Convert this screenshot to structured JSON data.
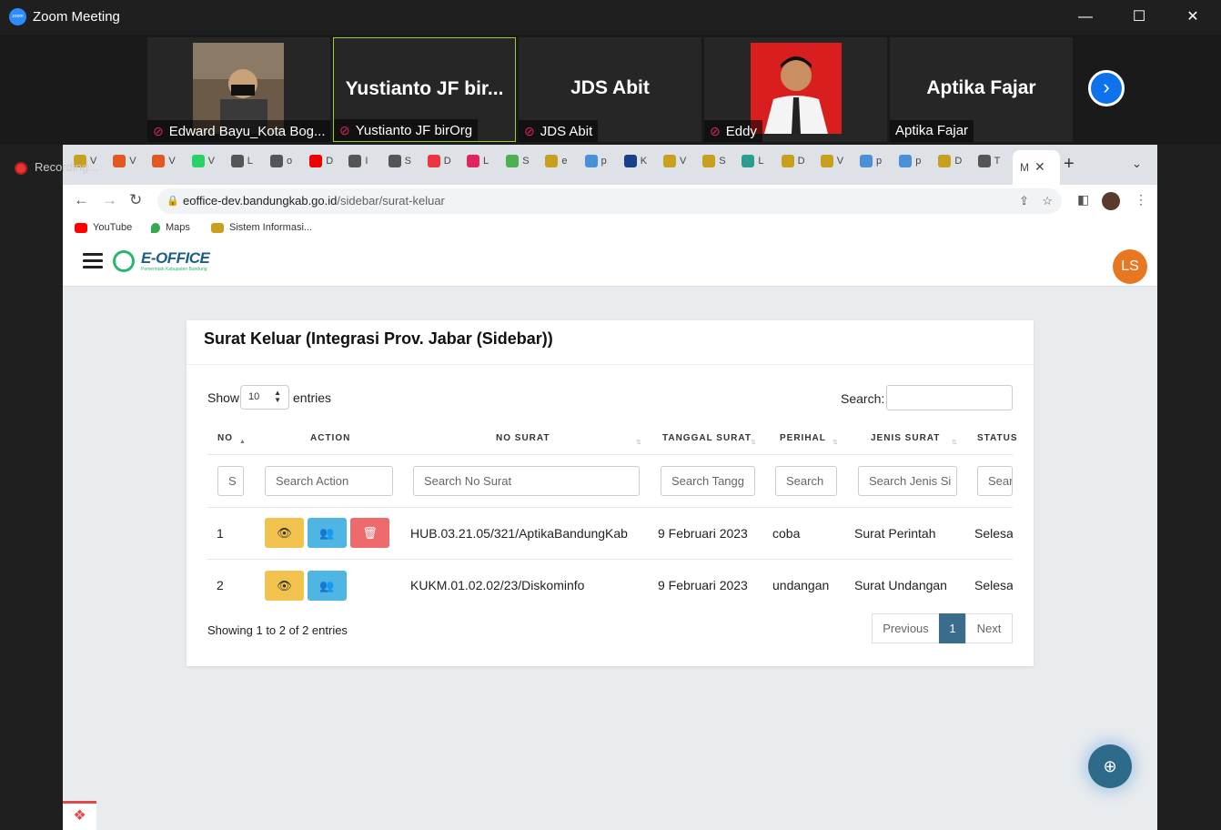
{
  "zoom": {
    "title": "Zoom Meeting",
    "logo_text": "zoom",
    "recording_label": "Recording...",
    "participants": [
      {
        "label": "Edward Bayu_Kota Bog...",
        "big_name": "",
        "muted": true
      },
      {
        "label": "Yustianto JF birOrg",
        "big_name": "Yustianto JF bir...",
        "muted": true
      },
      {
        "label": "JDS Abit",
        "big_name": "JDS Abit",
        "muted": true
      },
      {
        "label": "Eddy",
        "big_name": "",
        "muted": true
      },
      {
        "label": "Aptika Fajar",
        "big_name": "Aptika Fajar",
        "muted": false
      }
    ]
  },
  "browser": {
    "tabs": [
      "V",
      "V",
      "V",
      "V",
      "L",
      "o",
      "D",
      "I",
      "S",
      "D",
      "L",
      "S",
      "e",
      "p",
      "K",
      "V",
      "S",
      "L",
      "D",
      "V",
      "p",
      "p",
      "D",
      "T"
    ],
    "active_tab": "M",
    "url_host": "eoffice-dev.bandungkab.go.id",
    "url_path": "/sidebar/surat-keluar",
    "bookmarks": [
      "YouTube",
      "Maps",
      "Sistem Informasi..."
    ]
  },
  "app": {
    "logo": "E-OFFICE",
    "logo_sub": "Pemerintah Kabupaten Bandung",
    "avatar": "LS"
  },
  "card": {
    "title": "Surat Keluar (Integrasi Prov. Jabar (Sidebar))",
    "show_label": "Show",
    "show_value": "10",
    "entries_label": "entries",
    "search_label": "Search:",
    "columns": [
      "NO",
      "ACTION",
      "NO SURAT",
      "TANGGAL SURAT",
      "PERIHAL",
      "JENIS SURAT",
      "STATUS"
    ],
    "filters": [
      "S",
      "Search Action",
      "Search No Surat",
      "Search Tangg",
      "Search",
      "Search Jenis Si",
      "Sear"
    ],
    "rows": [
      {
        "no": "1",
        "no_surat": "HUB.03.21.05/321/AptikaBandungKab",
        "tanggal": "9 Februari 2023",
        "perihal": "coba",
        "jenis": "Surat Perintah",
        "status": "Selesa"
      },
      {
        "no": "2",
        "no_surat": "KUKM.01.02.02/23/Diskominfo",
        "tanggal": "9 Februari 2023",
        "perihal": "undangan",
        "jenis": "Surat Undangan",
        "status": "Selesa"
      }
    ],
    "info": "Showing 1 to 2 of 2 entries",
    "pager": {
      "prev": "Previous",
      "page": "1",
      "next": "Next"
    }
  },
  "colors": {
    "accent": "#3a6c8c",
    "view": "#f2c24f",
    "user": "#4fb6e3",
    "delete": "#ef6b6b",
    "avatar": "#e87722"
  }
}
